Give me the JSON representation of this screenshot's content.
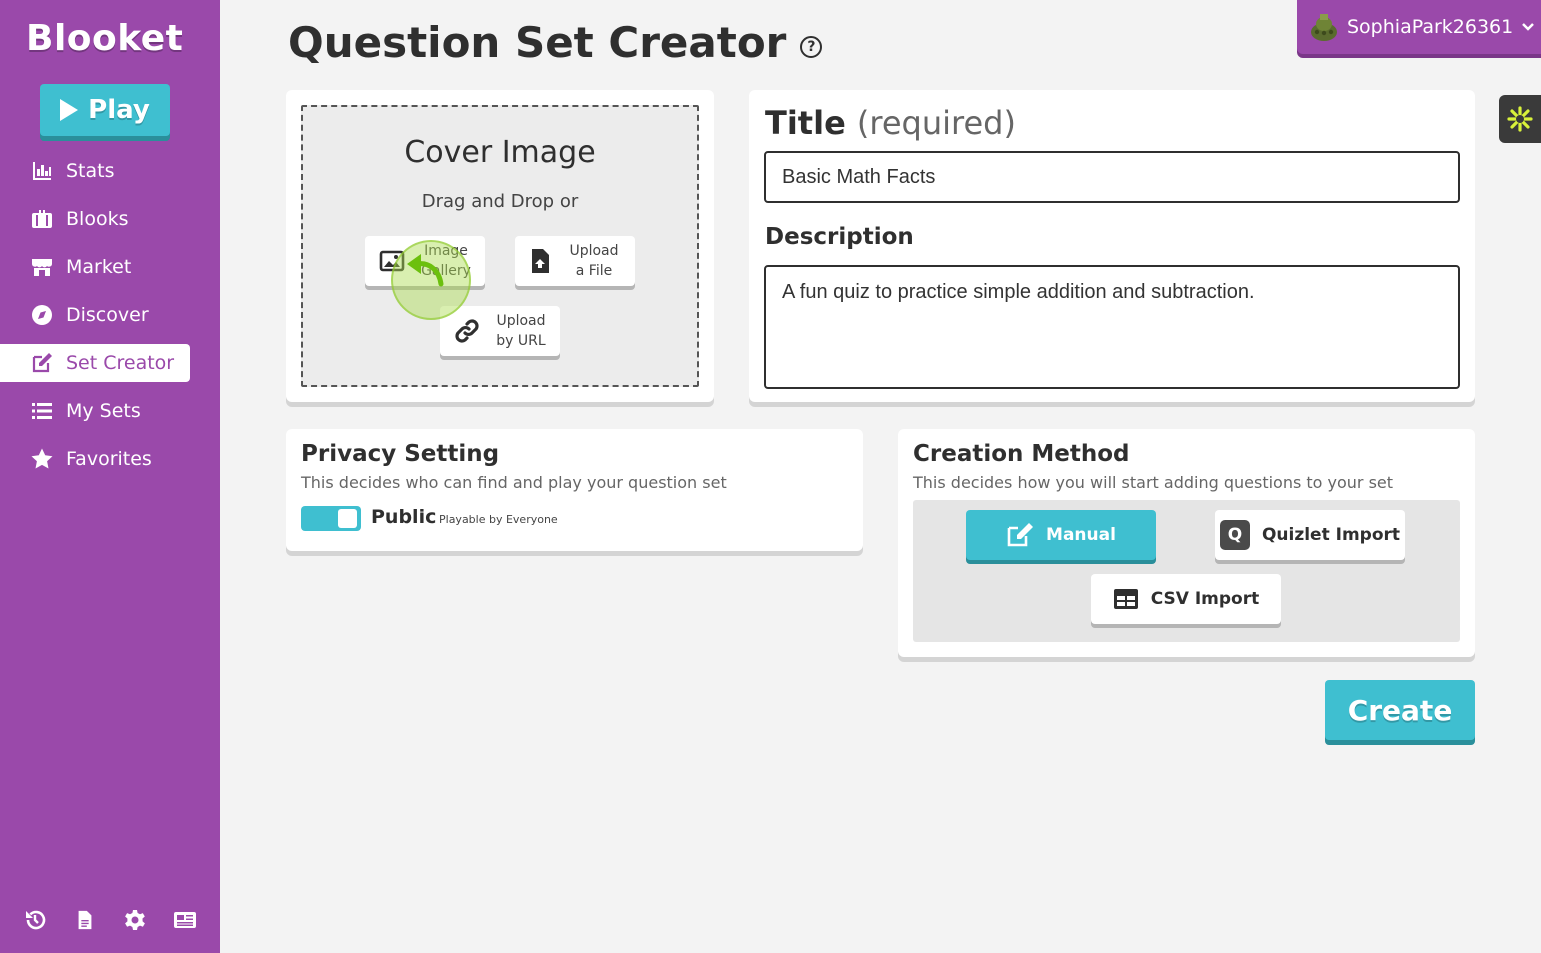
{
  "sidebar": {
    "logo": "Blooket",
    "play_label": "Play",
    "items": [
      {
        "label": "Stats",
        "icon": "stats-icon"
      },
      {
        "label": "Blooks",
        "icon": "blooks-icon"
      },
      {
        "label": "Market",
        "icon": "market-icon"
      },
      {
        "label": "Discover",
        "icon": "compass-icon"
      },
      {
        "label": "Set Creator",
        "icon": "edit-icon",
        "active": true
      },
      {
        "label": "My Sets",
        "icon": "list-icon"
      },
      {
        "label": "Favorites",
        "icon": "star-icon"
      }
    ],
    "bottom_icons": [
      "history-icon",
      "document-icon",
      "gear-icon",
      "newspaper-icon"
    ]
  },
  "header": {
    "title": "Question Set Creator",
    "help_glyph": "?",
    "username": "SophiaPark26361"
  },
  "cover": {
    "title": "Cover Image",
    "drag_text": "Drag and Drop or",
    "gallery_label_1": "Image",
    "gallery_label_2": "Gallery",
    "file_label_1": "Upload",
    "file_label_2": "a File",
    "url_label_1": "Upload",
    "url_label_2": "by URL"
  },
  "details": {
    "title_label": "Title",
    "title_required": "(required)",
    "title_value": "Basic Math Facts",
    "description_label": "Description",
    "description_value": "A fun quiz to practice simple addition and subtraction."
  },
  "privacy": {
    "heading": "Privacy Setting",
    "subtext": "This decides who can find and play your question set",
    "toggle_on": true,
    "value_label": "Public",
    "value_subtext": "Playable by Everyone"
  },
  "method": {
    "heading": "Creation Method",
    "subtext": "This decides how you will start adding questions to your set",
    "manual_label": "Manual",
    "quizlet_label": "Quizlet Import",
    "quizlet_glyph": "Q",
    "csv_label": "CSV Import"
  },
  "create_label": "Create",
  "colors": {
    "sidebar": "#9a49aa",
    "accent": "#3fbfd0",
    "background": "#f3f3f3"
  }
}
